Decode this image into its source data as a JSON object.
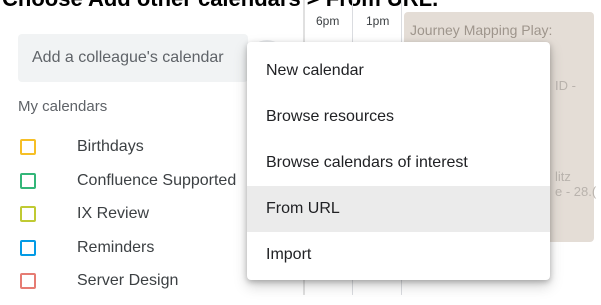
{
  "caption": "Choose Add other calendars > From URL.",
  "search": {
    "placeholder": "Add a colleague's calendar"
  },
  "my_calendars": {
    "title": "My calendars",
    "items": [
      {
        "label": "Birthdays",
        "color": "#f6bf26"
      },
      {
        "label": "Confluence Supported",
        "color": "#33b679"
      },
      {
        "label": "IX Review",
        "color": "#c0ca33"
      },
      {
        "label": "Reminders",
        "color": "#039be5"
      },
      {
        "label": "Server Design",
        "color": "#e67c73"
      }
    ]
  },
  "calendar_grid": {
    "time_labels": [
      "6pm",
      "1pm"
    ],
    "event_title": "Journey Mapping Play:",
    "fragments": [
      "ID -",
      "litz",
      "e - 28.("
    ]
  },
  "menu": {
    "items": [
      {
        "label": "New calendar"
      },
      {
        "label": "Browse resources"
      },
      {
        "label": "Browse calendars of interest"
      },
      {
        "label": "From URL",
        "hovered": true
      },
      {
        "label": "Import"
      }
    ]
  }
}
